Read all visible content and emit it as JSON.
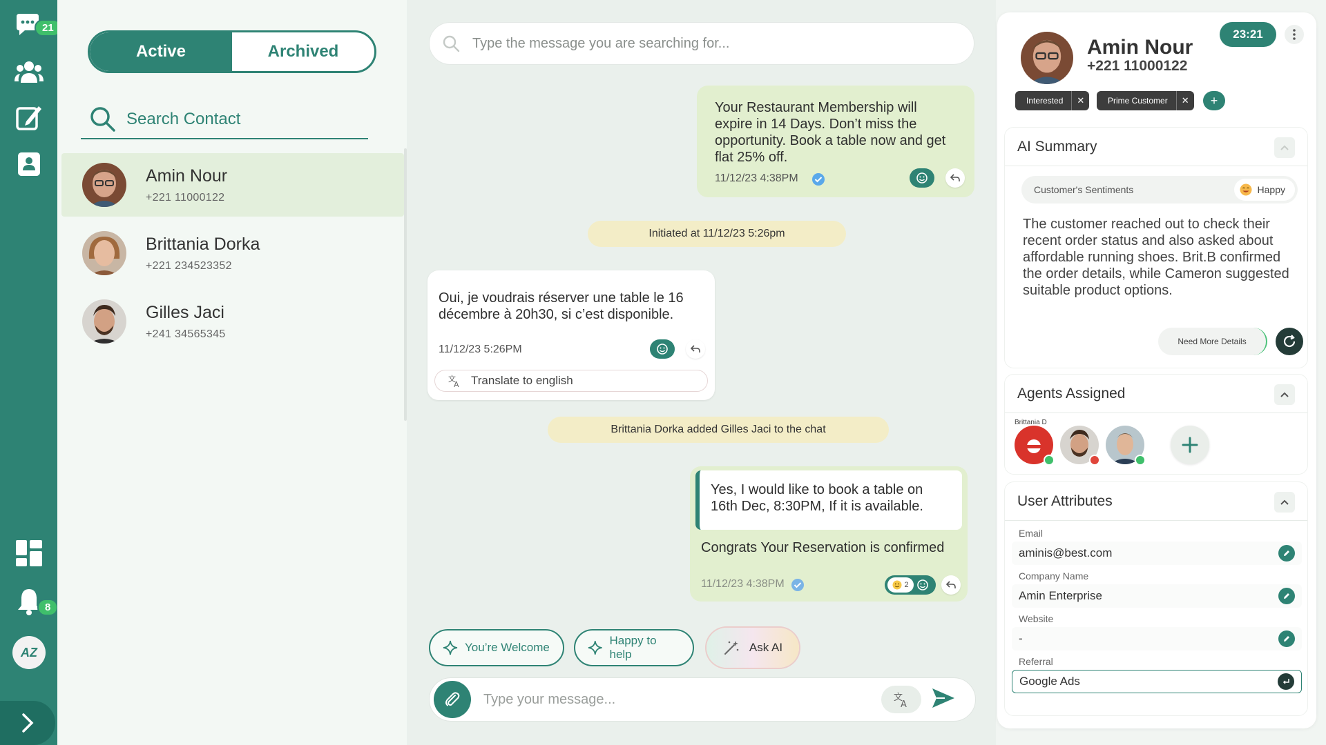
{
  "rail": {
    "chat_badge": "21",
    "notif_badge": "8",
    "brand": "AZ"
  },
  "contacts": {
    "tabs": [
      {
        "label": "Active"
      },
      {
        "label": "Archived"
      }
    ],
    "search_placeholder": "Search Contact",
    "items": [
      {
        "name": "Amin Nour",
        "phone": "+221 11000122"
      },
      {
        "name": "Brittania Dorka",
        "phone": "+221 234523352"
      },
      {
        "name": "Gilles Jaci",
        "phone": "+241 34565345"
      }
    ]
  },
  "chat": {
    "search_placeholder": "Type the message you are searching for...",
    "msg1": {
      "text": "Your Restaurant Membership will expire in 14 Days. Don’t miss the opportunity. Book a table now and get flat 25% off.",
      "time": "11/12/23 4:38PM"
    },
    "system1": "Initiated at 11/12/23 5:26pm",
    "msg2": {
      "text": "Oui, je voudrais réserver une table le 16 décembre à 20h30, si c’est disponible.",
      "time": "11/12/23 5:26PM",
      "translate": "Translate to english"
    },
    "system2": "Brittania Dorka added Gilles Jaci to the chat",
    "msg3": {
      "quote": "Yes, I would like to book a table on 16th Dec, 8:30PM, If it is available.",
      "text": "Congrats Your Reservation is confirmed",
      "time": "11/12/23 4:38PM",
      "reaction_count": "2"
    },
    "quick_replies": [
      "You’re Welcome",
      "Happy to help"
    ],
    "ask_ai": "Ask AI",
    "composer_placeholder": "Type your message..."
  },
  "panel": {
    "name": "Amin Nour",
    "phone": "+221 11000122",
    "time": "23:21",
    "tags": [
      "Interested",
      "Prime Customer"
    ],
    "ai_summary": {
      "title": "AI Summary",
      "sentiment_label": "Customer's Sentiments",
      "sentiment_value": "Happy",
      "text": "The customer reached out to check their recent order status and also asked about affordable running shoes. Brit.B confirmed the order details, while Cameron suggested suitable product options.",
      "need_more": "Need More Details"
    },
    "agents": {
      "title": "Agents Assigned",
      "first_label": "Brittania D"
    },
    "attributes": {
      "title": "User Attributes",
      "items": [
        {
          "label": "Email",
          "value": "aminis@best.com"
        },
        {
          "label": "Company Name",
          "value": "Amin Enterprise"
        },
        {
          "label": "Website",
          "value": "-"
        },
        {
          "label": "Referral",
          "value": "Google Ads"
        }
      ]
    }
  },
  "colors": {
    "primary": "#2e8374",
    "badge": "#3fbf6b",
    "outgoing": "#e2efcf",
    "system": "#f3edc7"
  }
}
